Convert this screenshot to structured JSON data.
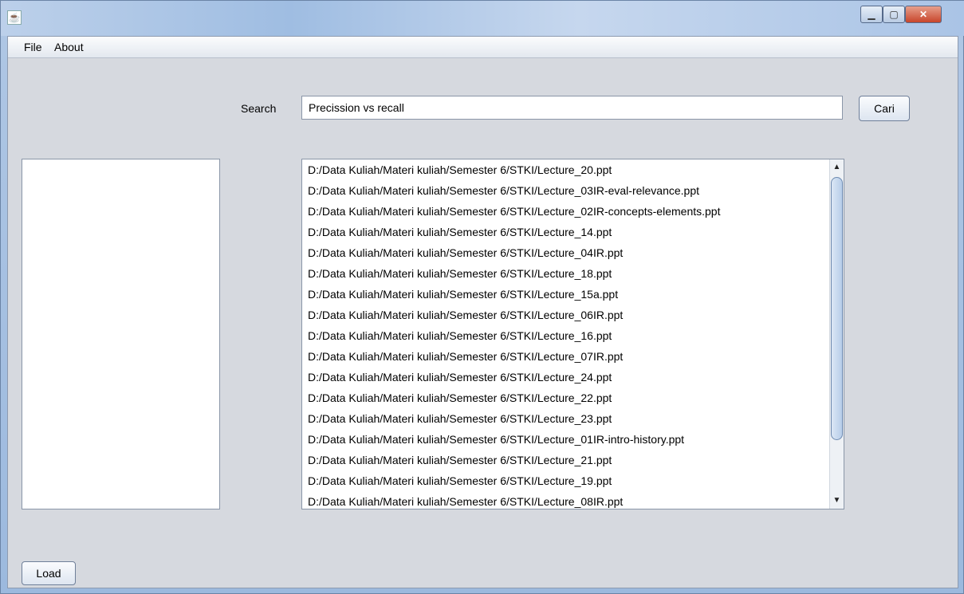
{
  "menubar": {
    "items": [
      "File",
      "About"
    ]
  },
  "search": {
    "label": "Search",
    "value": "Precission vs recall",
    "button": "Cari"
  },
  "results": [
    "D:/Data Kuliah/Materi kuliah/Semester 6/STKI/Lecture_20.ppt",
    "D:/Data Kuliah/Materi kuliah/Semester 6/STKI/Lecture_03IR-eval-relevance.ppt",
    "D:/Data Kuliah/Materi kuliah/Semester 6/STKI/Lecture_02IR-concepts-elements.ppt",
    "D:/Data Kuliah/Materi kuliah/Semester 6/STKI/Lecture_14.ppt",
    "D:/Data Kuliah/Materi kuliah/Semester 6/STKI/Lecture_04IR.ppt",
    "D:/Data Kuliah/Materi kuliah/Semester 6/STKI/Lecture_18.ppt",
    "D:/Data Kuliah/Materi kuliah/Semester 6/STKI/Lecture_15a.ppt",
    "D:/Data Kuliah/Materi kuliah/Semester 6/STKI/Lecture_06IR.ppt",
    "D:/Data Kuliah/Materi kuliah/Semester 6/STKI/Lecture_16.ppt",
    "D:/Data Kuliah/Materi kuliah/Semester 6/STKI/Lecture_07IR.ppt",
    "D:/Data Kuliah/Materi kuliah/Semester 6/STKI/Lecture_24.ppt",
    "D:/Data Kuliah/Materi kuliah/Semester 6/STKI/Lecture_22.ppt",
    "D:/Data Kuliah/Materi kuliah/Semester 6/STKI/Lecture_23.ppt",
    "D:/Data Kuliah/Materi kuliah/Semester 6/STKI/Lecture_01IR-intro-history.ppt",
    "D:/Data Kuliah/Materi kuliah/Semester 6/STKI/Lecture_21.ppt",
    "D:/Data Kuliah/Materi kuliah/Semester 6/STKI/Lecture_19.ppt",
    "D:/Data Kuliah/Materi kuliah/Semester 6/STKI/Lecture_08IR.ppt"
  ],
  "load_button": "Load",
  "icons": {
    "app": "java-icon",
    "minimize": "minimize-icon",
    "maximize": "maximize-icon",
    "close": "close-icon"
  },
  "colors": {
    "window_bg": "#d6d9df",
    "title_bar": "#aec6e4",
    "close_button": "#c8452b"
  }
}
